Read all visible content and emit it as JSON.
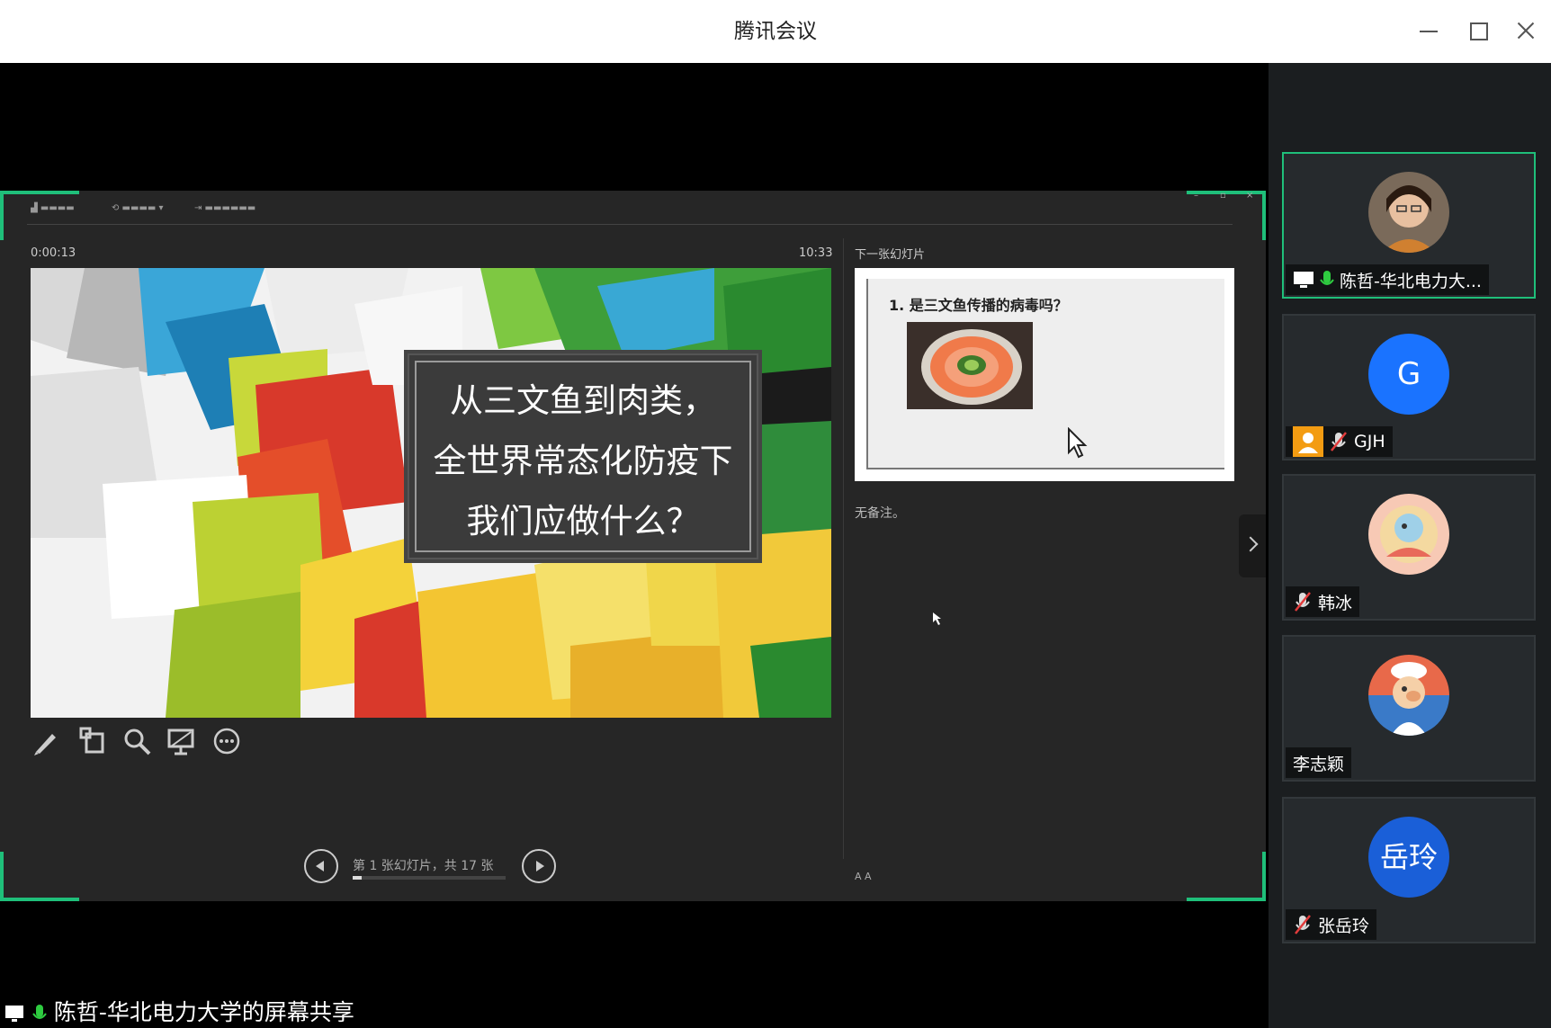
{
  "window": {
    "title": "腾讯会议"
  },
  "presenter": {
    "timer": "0:00:13",
    "clock": "10:33",
    "next_label": "下一张幻灯片",
    "slide_lines": [
      "从三文鱼到肉类，",
      "全世界常态化防疫下",
      "我们应做什么？"
    ],
    "next_slide_question": "1. 是三文鱼传播的病毒吗？",
    "notes": "无备注。",
    "slide_count_text": "第 1 张幻灯片，共 17 张",
    "progress": 0.06,
    "font_buttons": "A  A",
    "tools": [
      "pen-icon",
      "laser-icon",
      "zoom-icon",
      "screen-icon",
      "more-icon"
    ]
  },
  "share_label": "陈哲-华北电力大学的屏幕共享",
  "participants": [
    {
      "name": "陈哲-华北电力大...",
      "avatar": "photo",
      "mic": "on",
      "sharing": true,
      "active": true
    },
    {
      "name": "GJH",
      "avatar_text": "G",
      "mic": "muted",
      "has_person_icon": true
    },
    {
      "name": "韩冰",
      "avatar": "cartoon-peach",
      "mic": "muted"
    },
    {
      "name": "李志颖",
      "avatar": "cartoon-chef",
      "mic": "none"
    },
    {
      "name": "张岳玲",
      "avatar_text": "岳玲",
      "mic": "muted"
    }
  ],
  "colors": {
    "accent": "#1fbf7a",
    "avatar_blue": "#1a73ff",
    "mic_green": "#2ecc40",
    "mic_muted": "#e23c3c"
  }
}
